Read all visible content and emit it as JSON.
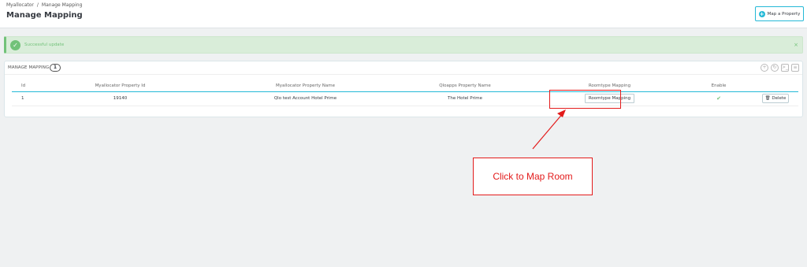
{
  "header": {
    "breadcrumb": [
      "Myallocator",
      "Manage Mapping"
    ],
    "breadcrumb_sep": "/",
    "title": "Manage Mapping",
    "map_button_label": "Map a Property",
    "map_button_icon": "plus-circle-icon"
  },
  "alert": {
    "message": "Successful update",
    "close": "×",
    "icon": "check-circle-icon"
  },
  "panel": {
    "title": "MANAGE MAPPING",
    "count": "1",
    "tools": [
      "add-icon",
      "refresh-icon",
      "terminal-icon",
      "database-icon"
    ],
    "columns": [
      "Id",
      "Myallocator Property Id",
      "Myallocator Property Name",
      "Qloapps Property Name",
      "Roomtype Mapping",
      "Enable",
      ""
    ],
    "rows": [
      {
        "id": "1",
        "property_id": "19140",
        "property_name": "Qlo test Account Hotel Prime",
        "qlo_name": "The Hotel Prime",
        "mapping_button": "Roomtype Mapping",
        "enable_icon": "check-icon",
        "delete_label": "Delete"
      }
    ]
  },
  "annotation": {
    "text": "Click to Map Room"
  },
  "colors": {
    "accent": "#25b9d7",
    "success": "#72c279",
    "annotation": "#e31b1b"
  }
}
